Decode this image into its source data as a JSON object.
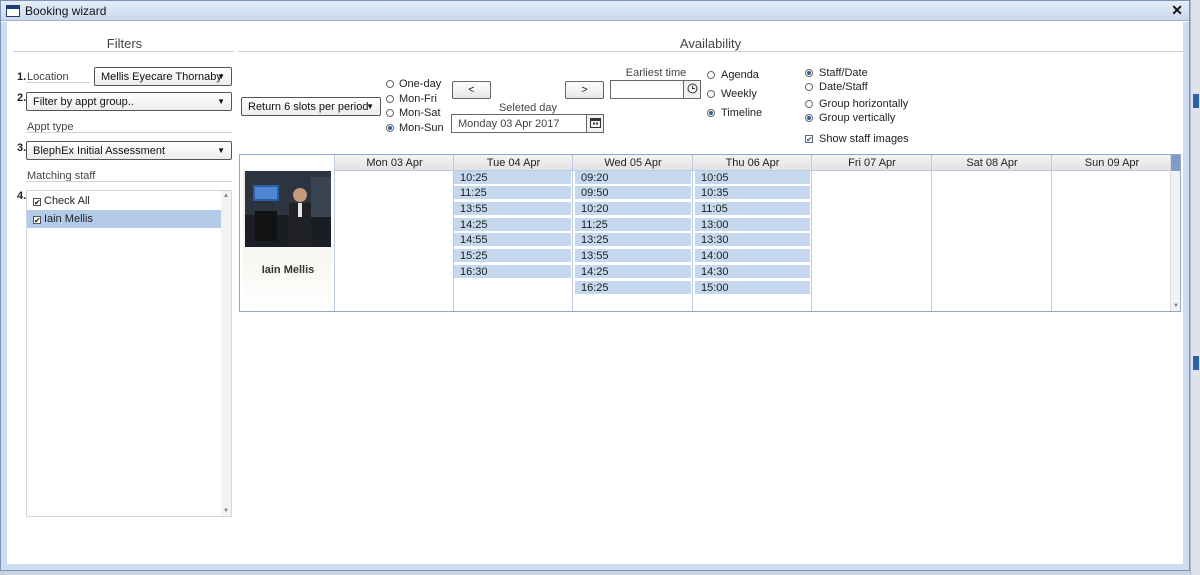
{
  "window": {
    "title": "Booking wizard"
  },
  "filters": {
    "heading": "Filters",
    "location_num": "1.",
    "location_label": "Location",
    "location_value": "Mellis Eyecare Thornaby",
    "group_num": "2.",
    "group_value": "Filter by appt group..",
    "appt_type_label": "Appt type",
    "appt_num": "3.",
    "appt_value": "BlephEx Initial Assessment",
    "staff_label": "Matching staff",
    "staff_num": "4.",
    "staff_items": [
      {
        "label": "Check All",
        "checked": true
      },
      {
        "label": "Iain Mellis",
        "checked": true,
        "selected": true
      }
    ]
  },
  "availability": {
    "heading": "Availability",
    "slots_select": "Return 6 slots per period",
    "range_options": [
      "One-day",
      "Mon-Fri",
      "Mon-Sat",
      "Mon-Sun"
    ],
    "range_selected": "Mon-Sun",
    "prev_label": "<",
    "next_label": ">",
    "selected_day_label": "Seleted day",
    "selected_day_value": "Monday 03 Apr 2017",
    "earliest_time_label": "Earliest time",
    "earliest_time_value": "",
    "view_options": [
      "Agenda",
      "Weekly",
      "Timeline"
    ],
    "view_selected": "Timeline",
    "order_options": [
      "Staff/Date",
      "Date/Staff"
    ],
    "order_selected": "Staff/Date",
    "group_options": [
      "Group horizontally",
      "Group vertically"
    ],
    "group_selected": "Group vertically",
    "show_images_label": "Show staff images",
    "show_images": true
  },
  "schedule": {
    "staff": "Iain Mellis",
    "days": [
      {
        "label": "Mon 03 Apr",
        "slots": []
      },
      {
        "label": "Tue 04 Apr",
        "slots": [
          "10:25",
          "11:25",
          "13:55",
          "14:25",
          "14:55",
          "15:25",
          "16:30"
        ]
      },
      {
        "label": "Wed 05 Apr",
        "slots": [
          "09:20",
          "09:50",
          "10:20",
          "11:25",
          "13:25",
          "13:55",
          "14:25",
          "16:25"
        ]
      },
      {
        "label": "Thu 06 Apr",
        "slots": [
          "10:05",
          "10:35",
          "11:05",
          "13:00",
          "13:30",
          "14:00",
          "14:30",
          "15:00"
        ]
      },
      {
        "label": "Fri 07 Apr",
        "slots": []
      },
      {
        "label": "Sat 08 Apr",
        "slots": []
      },
      {
        "label": "Sun 09 Apr",
        "slots": []
      }
    ]
  },
  "icons": {
    "close": "close-icon",
    "clock": "clock-icon",
    "calendar": "calendar-icon",
    "dropdown": "chevron-down-icon"
  }
}
